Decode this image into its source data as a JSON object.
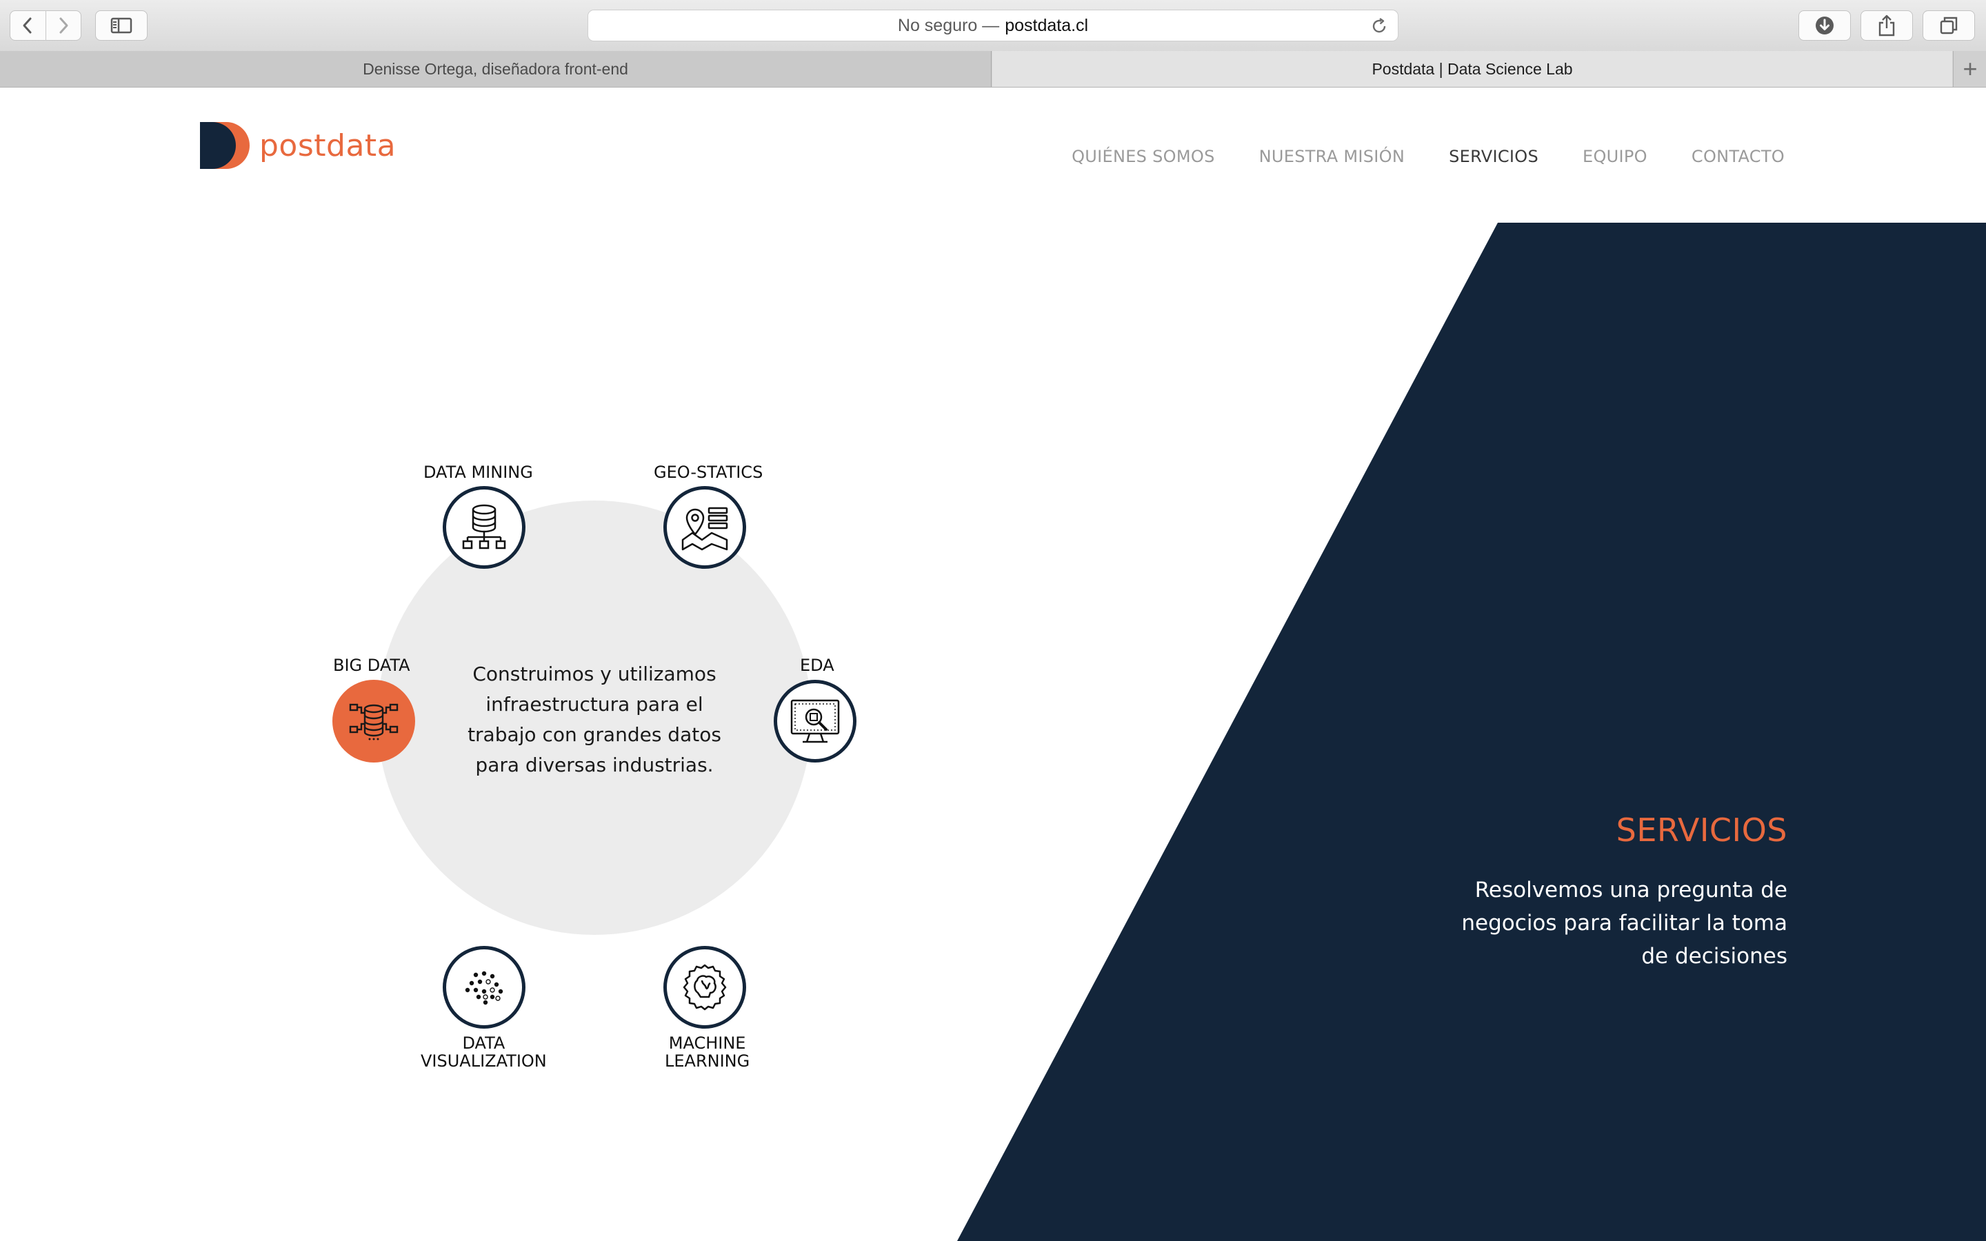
{
  "browser": {
    "address": {
      "security": "No seguro —",
      "domain": "postdata.cl"
    },
    "tabs": [
      {
        "title": "Denisse Ortega, diseñadora front-end"
      },
      {
        "title": "Postdata | Data Science Lab"
      }
    ],
    "new_tab_symbol": "+"
  },
  "site": {
    "logo_text": "postdata",
    "nav": [
      {
        "label": "QUIÉNES SOMOS"
      },
      {
        "label": "NUESTRA MISIÓN"
      },
      {
        "label": "SERVICIOS"
      },
      {
        "label": "EQUIPO"
      },
      {
        "label": "CONTACTO"
      }
    ],
    "active_nav": "SERVICIOS"
  },
  "services": {
    "center_text": "Construimos y utilizamos infraestructura para el trabajo con grandes datos para diversas industrias.",
    "items": [
      {
        "label": "DATA MINING",
        "icon": "database-network-icon"
      },
      {
        "label": "GEO-STATICS",
        "icon": "map-pin-icon"
      },
      {
        "label": "EDA",
        "icon": "monitor-magnifier-icon"
      },
      {
        "label": "MACHINE LEARNING",
        "icon": "gear-brain-icon"
      },
      {
        "label": "DATA VISUALIZATION",
        "icon": "dot-pattern-icon"
      },
      {
        "label": "BIG DATA",
        "icon": "database-connections-icon"
      }
    ],
    "active_item": "BIG DATA"
  },
  "hero": {
    "title": "SERVICIOS",
    "text": "Resolvemos una pregunta de negocios para facilitar la toma de decisiones"
  },
  "colors": {
    "accent": "#e8693e",
    "navy": "#13253a",
    "wheel_bg": "#ececec"
  }
}
